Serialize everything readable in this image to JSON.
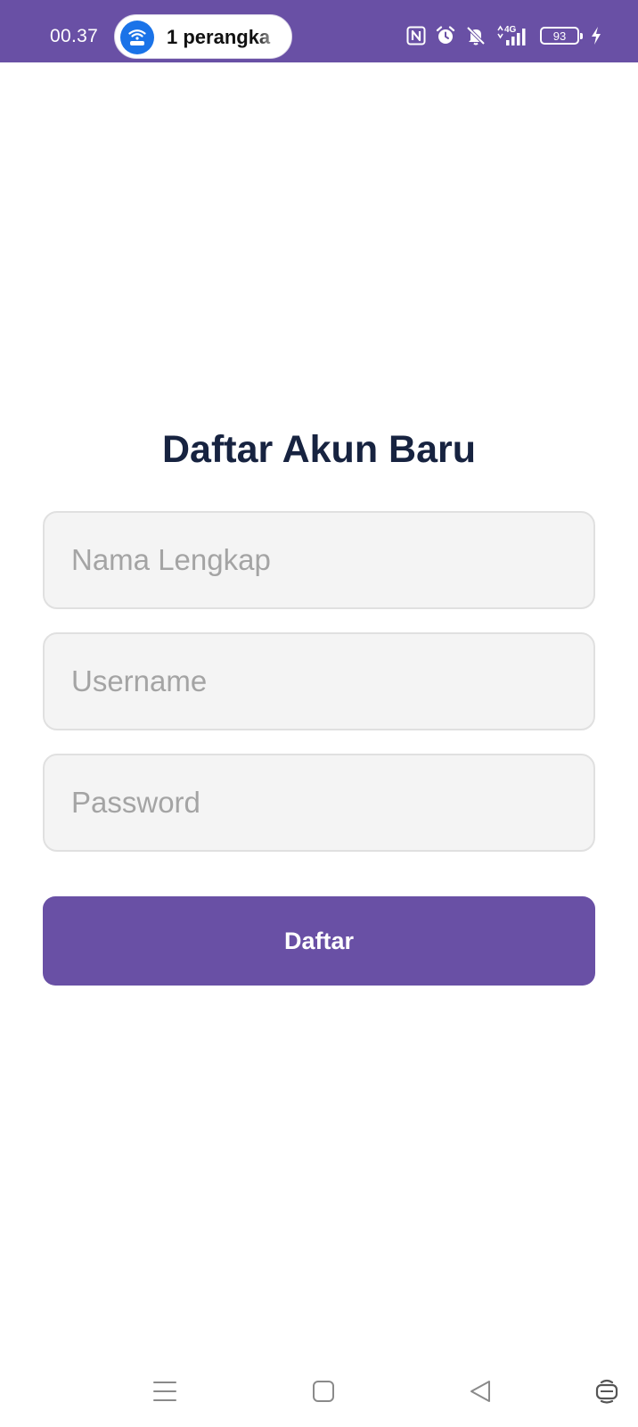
{
  "status_bar": {
    "time": "00.37",
    "hotspot_text": "1 perangka",
    "battery": "93",
    "network": "4G",
    "icons": [
      "hotspot-icon",
      "nfc-icon",
      "alarm-icon",
      "mute-icon",
      "signal-icon",
      "battery-icon",
      "charging-icon"
    ]
  },
  "form": {
    "title": "Daftar Akun Baru",
    "full_name_placeholder": "Nama Lengkap",
    "username_placeholder": "Username",
    "password_placeholder": "Password",
    "submit_label": "Daftar"
  },
  "nav_bar": {
    "icons": [
      "menu-icon",
      "home-icon",
      "back-icon",
      "assistant-icon"
    ]
  },
  "colors": {
    "primary": "#6950a5",
    "title": "#172340",
    "input_background": "#f4f4f4",
    "input_border": "#e0e0e0",
    "placeholder": "#a4a4a4",
    "hotspot_blue": "#1a73e8"
  }
}
